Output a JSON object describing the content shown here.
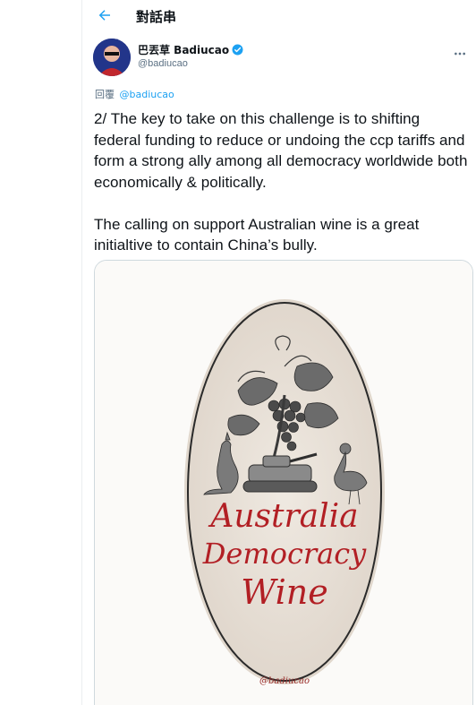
{
  "header": {
    "back_icon": "arrow-left-icon",
    "title": "對話串"
  },
  "tweet": {
    "display_name": "巴丟草 Badiucao",
    "handle": "@badiucao",
    "reply_prefix": "回覆",
    "reply_handle": "@badiucao",
    "text": "2/ The key to take on this challenge is to shifting federal funding to reduce or undoing the ccp tariffs and form a strong ally among all democracy worldwide both economically & politically.\n\nThe calling on support Australian wine is a great initialtive to contain China’s bully."
  },
  "media": {
    "label_line1": "Australia",
    "label_line2": "Democracy",
    "label_line3": "Wine",
    "signature": "@badiucao"
  },
  "colors": {
    "accent": "#1da1f2",
    "text_primary": "#0f1419",
    "text_secondary": "#5b7083",
    "wine_red": "#b21f24"
  }
}
